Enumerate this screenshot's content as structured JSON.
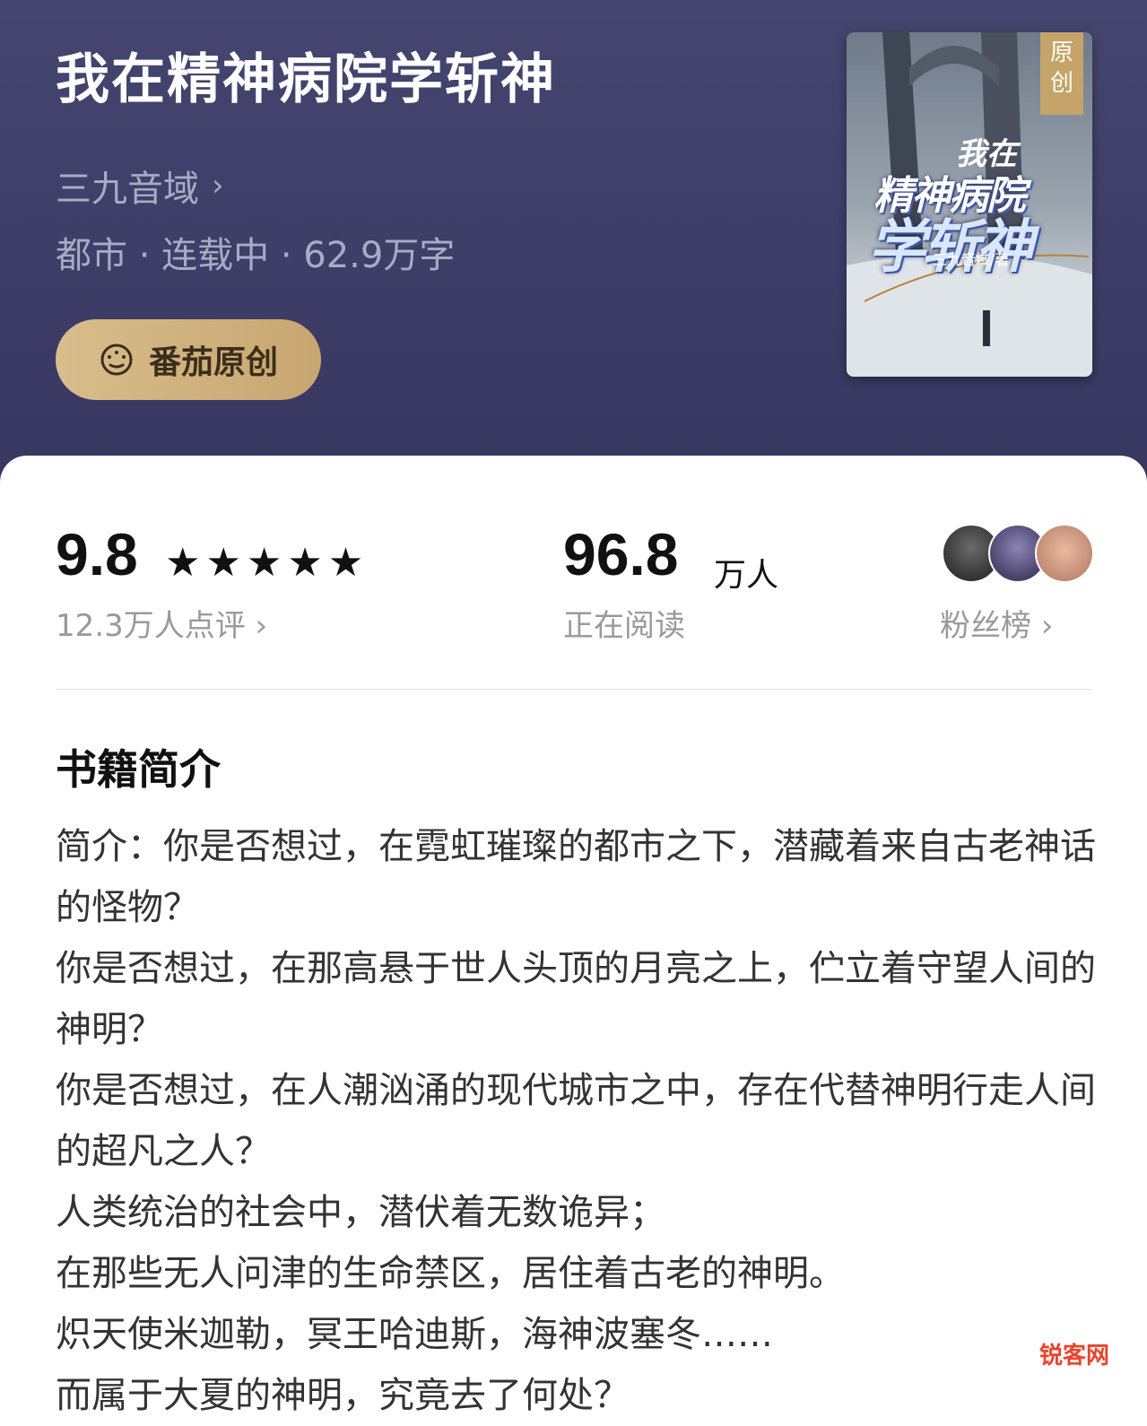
{
  "book": {
    "title": "我在精神病院学斩神",
    "author": "三九音域",
    "meta": "都市 · 连载中 · 62.9万字",
    "badge_label": "番茄原创",
    "cover_tag": "原创",
    "cover_title_line1": "我在",
    "cover_title_line2": "精神病院",
    "cover_title_line3": "学斩神",
    "cover_author": "三九音域/著"
  },
  "stats": {
    "score": "9.8",
    "stars": "★★★★★",
    "reviews": "12.3万人点评",
    "readers": "96.8",
    "readers_unit": "万人",
    "readers_label": "正在阅读",
    "fans_label": "粉丝榜"
  },
  "intro": {
    "heading": "书籍简介",
    "lines": [
      "简介：你是否想过，在霓虹璀璨的都市之下，潜藏着来自古老神话的怪物？",
      "你是否想过，在那高悬于世人头顶的月亮之上，伫立着守望人间的神明？",
      "你是否想过，在人潮汹涌的现代城市之中，存在代替神明行走人间的超凡之人？",
      "人类统治的社会中，潜伏着无数诡异；",
      "在那些无人问津的生命禁区，居住着古老的神明。",
      "炽天使米迦勒，冥王哈迪斯，海神波塞冬……",
      "而属于大夏的神明，究竟去了何处？"
    ]
  },
  "watermark": "锐客网",
  "colors": {
    "header_bg": "#3f3f69",
    "badge_gold": "#d2b684",
    "text_primary": "#111111",
    "text_secondary": "#9a9a9a"
  }
}
